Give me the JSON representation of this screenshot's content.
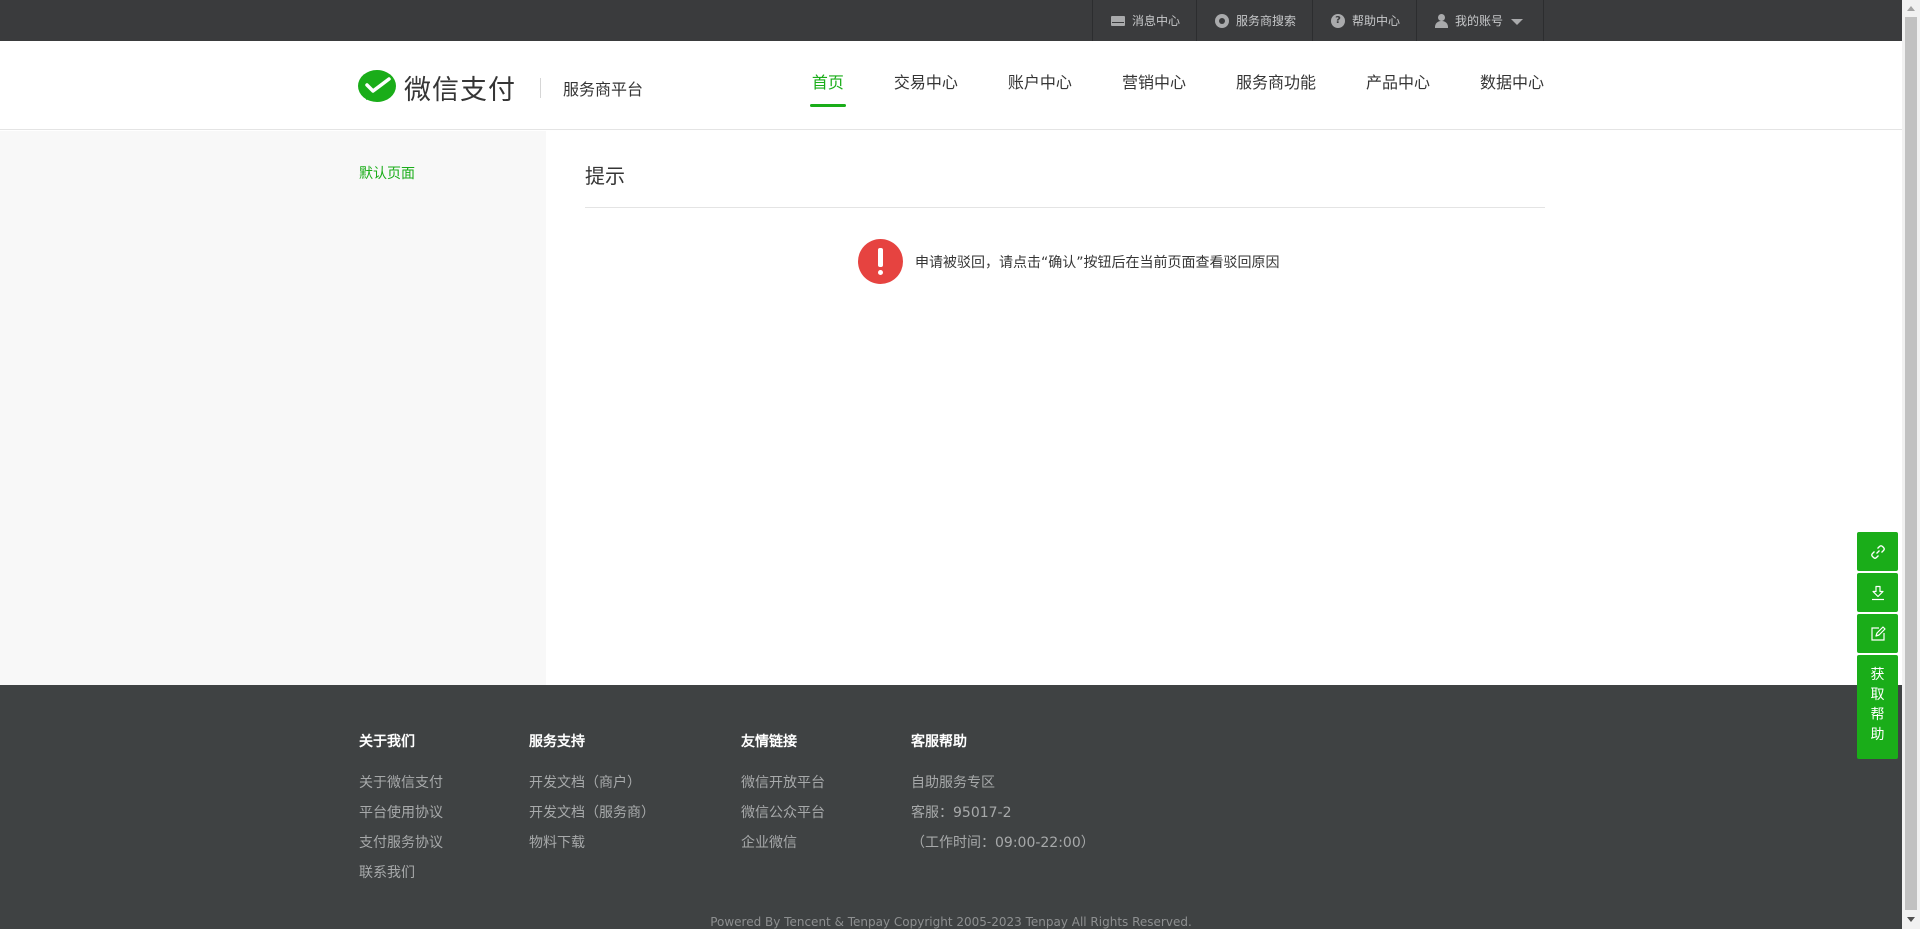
{
  "topbar": {
    "items": [
      {
        "label": "消息中心",
        "icon": "mail-icon"
      },
      {
        "label": "服务商搜索",
        "icon": "search-icon"
      },
      {
        "label": "帮助中心",
        "icon": "help-icon"
      },
      {
        "label": "我的账号",
        "icon": "user-icon"
      }
    ]
  },
  "header": {
    "logo_text": "微信支付",
    "logo_sub": "服务商平台",
    "nav": [
      {
        "label": "首页",
        "active": true
      },
      {
        "label": "交易中心"
      },
      {
        "label": "账户中心"
      },
      {
        "label": "营销中心"
      },
      {
        "label": "服务商功能"
      },
      {
        "label": "产品中心"
      },
      {
        "label": "数据中心"
      }
    ]
  },
  "sidebar": {
    "items": [
      {
        "label": "默认页面"
      }
    ]
  },
  "main": {
    "title": "提示",
    "tip_icon": "warning-icon",
    "tip_text": "申请被驳回，请点击“确认”按钮后在当前页面查看驳回原因"
  },
  "footer": {
    "columns": [
      {
        "title": "关于我们",
        "links": [
          "关于微信支付",
          "平台使用协议",
          "支付服务协议",
          "联系我们"
        ]
      },
      {
        "title": "服务支持",
        "links": [
          "开发文档（商户）",
          "开发文档（服务商）",
          "物料下载"
        ]
      },
      {
        "title": "友情链接",
        "links": [
          "微信开放平台",
          "微信公众平台",
          "企业微信"
        ]
      },
      {
        "title": "客服帮助",
        "links": [
          "自助服务专区",
          "客服：95017-2",
          "（工作时间：09:00-22:00）"
        ]
      }
    ],
    "copyright": "Powered By Tencent & Tenpay    Copyright 2005-2023 Tenpay All Rights Reserved."
  },
  "float_tools": {
    "buttons": [
      "link-icon",
      "download-icon",
      "edit-icon"
    ],
    "help_chars": [
      "获",
      "取",
      "帮",
      "助"
    ]
  },
  "colors": {
    "brand_green": "#1aad19",
    "topbar_bg": "#3a3b3d",
    "footer_bg": "#3f4243",
    "warning_red": "#e64340"
  }
}
